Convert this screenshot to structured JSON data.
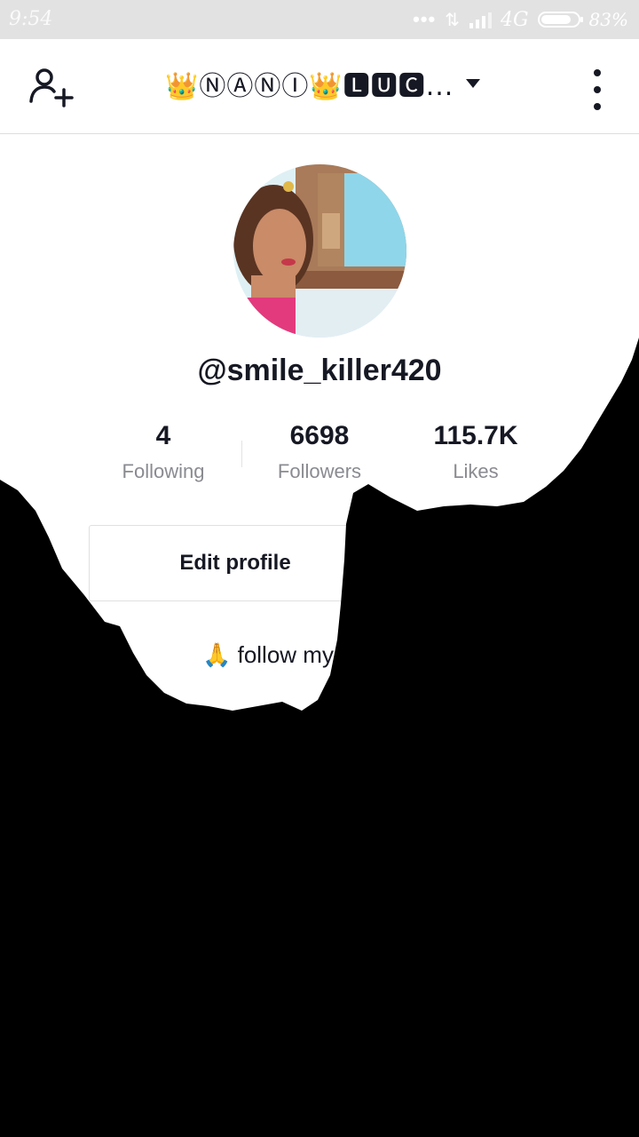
{
  "status_bar": {
    "time": "9:54",
    "network": "4G",
    "battery_percent": "83%",
    "battery_level": 0.83
  },
  "header": {
    "title": "👑ⓃⒶⓃⒾ👑🅻🆄🅲...",
    "add_user_icon": "person-plus-icon",
    "dropdown_icon": "caret-down-icon",
    "more_icon": "vertical-dots-icon"
  },
  "profile": {
    "username": "@smile_killer420",
    "stats": [
      {
        "value": "4",
        "label": "Following"
      },
      {
        "value": "6698",
        "label": "Followers"
      },
      {
        "value": "115.7K",
        "label": "Likes"
      }
    ],
    "edit_button": "Edit profile",
    "bio": "🙏 follow my"
  },
  "colors": {
    "text_primary": "#161823",
    "text_secondary": "#8a8b91",
    "overlay": "#000000"
  }
}
